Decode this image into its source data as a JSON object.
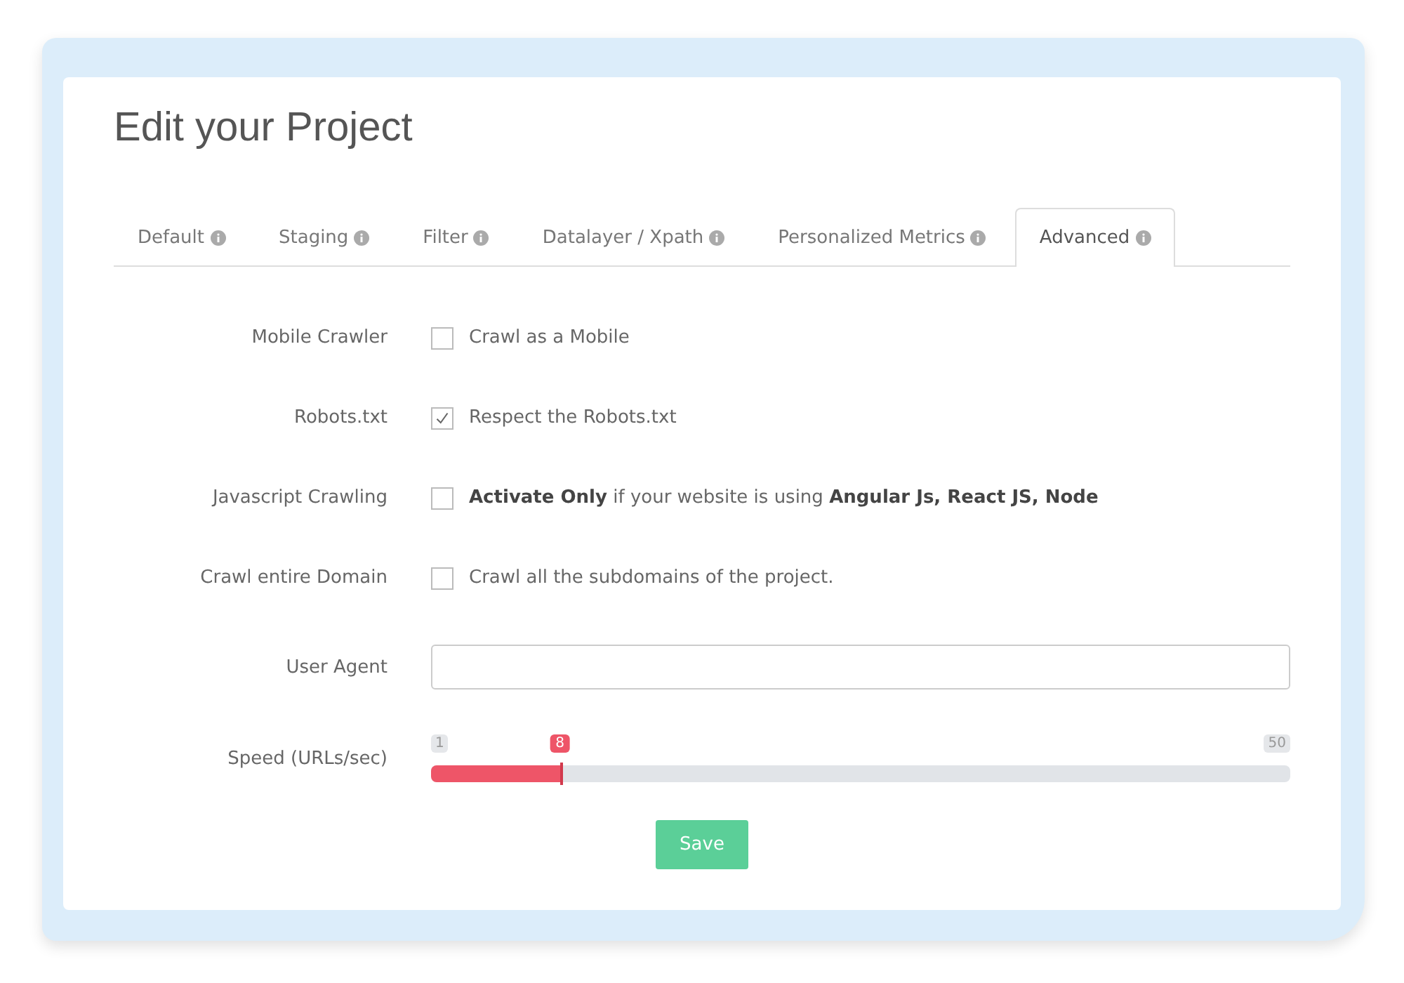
{
  "title": "Edit your Project",
  "tabs": [
    {
      "label": "Default",
      "selected": false
    },
    {
      "label": "Staging",
      "selected": false
    },
    {
      "label": "Filter",
      "selected": false
    },
    {
      "label": "Datalayer / Xpath",
      "selected": false
    },
    {
      "label": "Personalized Metrics",
      "selected": false
    },
    {
      "label": "Advanced",
      "selected": true
    }
  ],
  "options": [
    {
      "label": "Mobile Crawler",
      "text": "Crawl as a Mobile",
      "checked": false
    },
    {
      "label": "Robots.txt",
      "text": "Respect the Robots.txt",
      "checked": true
    },
    {
      "label": "Javascript Crawling",
      "text": "**Activate Only** if your website is using **Angular Js, React JS, Node**",
      "checked": false
    },
    {
      "label": "Crawl entire Domain",
      "text": "Crawl all the subdomains of the project.",
      "checked": false
    }
  ],
  "user_agent": {
    "label": "User Agent"
  },
  "speed": {
    "label": "Speed (URLs/sec)",
    "min": "1",
    "max": "50",
    "value": "8",
    "level": 0.15
  },
  "save_button": "Save"
}
